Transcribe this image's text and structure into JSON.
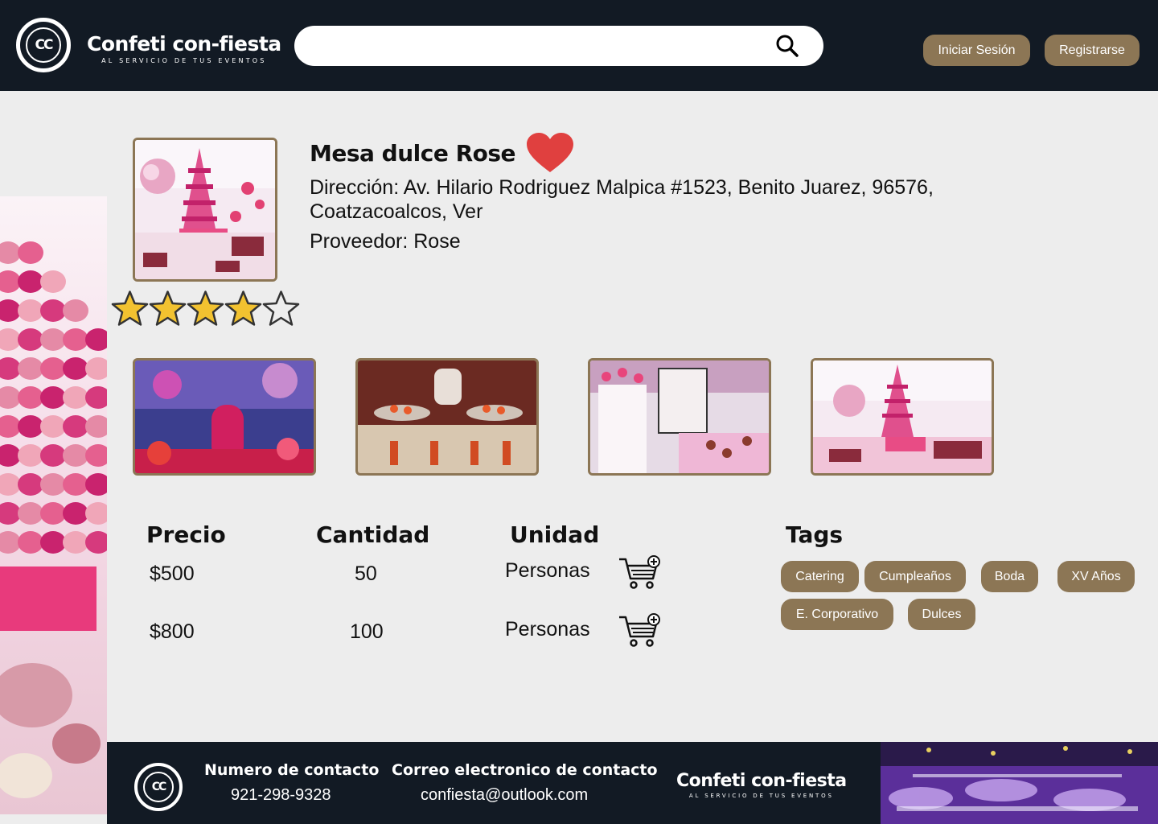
{
  "header": {
    "logo_initials": "CC",
    "brand_name": "Confeti con-fiesta",
    "brand_tagline": "AL SERVICIO DE TUS EVENTOS",
    "search": {
      "placeholder": "",
      "value": "",
      "icon": "search-icon"
    },
    "login_label": "Iniciar Sesión",
    "register_label": "Registrarse"
  },
  "product": {
    "title": "Mesa dulce Rose",
    "favorite_icon": "heart-icon",
    "favorite_color": "#e0403f",
    "address": "Dirección: Av. Hilario Rodriguez Malpica #1523, Benito Juarez, 96576, Coatzacoalcos, Ver",
    "provider": "Proveedor: Rose",
    "rating": {
      "value": 4,
      "max": 5
    }
  },
  "gallery": [
    {
      "alt": "Candy table with jars and lights"
    },
    {
      "alt": "Dessert stands with treats"
    },
    {
      "alt": "Pink candy bar display"
    },
    {
      "alt": "Macaron tower dessert table"
    }
  ],
  "pricing": {
    "headers": {
      "price": "Precio",
      "quantity": "Cantidad",
      "unit": "Unidad"
    },
    "rows": [
      {
        "price": "$500",
        "quantity": "50",
        "unit": "Personas",
        "icon": "add-to-cart-icon"
      },
      {
        "price": "$800",
        "quantity": "100",
        "unit": "Personas",
        "icon": "add-to-cart-icon"
      }
    ]
  },
  "tags": {
    "title": "Tags",
    "items": [
      "Catering",
      "Cumpleaños",
      "Boda",
      "XV Años",
      "E. Corporativo",
      "Dulces"
    ]
  },
  "footer": {
    "phone_label": "Numero de contacto",
    "phone": "921-298-9328",
    "email_label": "Correo electronico de contacto",
    "email": "confiesta@outlook.com",
    "brand_name": "Confeti con-fiesta",
    "brand_tagline": "AL SERVICIO DE TUS EVENTOS",
    "logo_initials": "CC"
  },
  "colors": {
    "header_bg": "#121a24",
    "accent": "#8c7655",
    "page_bg": "#ededed",
    "star": "#f2c230"
  }
}
